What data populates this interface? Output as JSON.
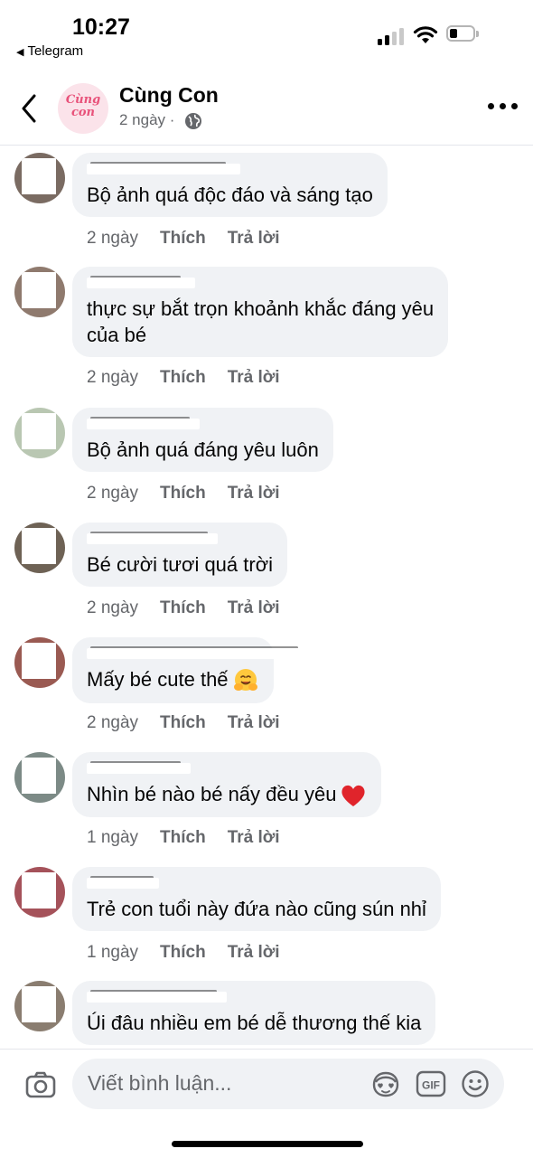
{
  "status_bar": {
    "time": "10:27",
    "back_app": "Telegram"
  },
  "header": {
    "page_name": "Cùng Con",
    "logo_text_line1": "Cùng",
    "logo_text_line2": "con",
    "time_ago": "2 ngày",
    "separator": "·"
  },
  "comments": [
    {
      "text": "Bộ ảnh quá độc đáo và sáng tạo",
      "time": "2 ngày",
      "like": "Thích",
      "reply": "Trả lời"
    },
    {
      "text": "thực sự bắt trọn khoảnh khắc đáng yêu\ncủa bé",
      "time": "2 ngày",
      "like": "Thích",
      "reply": "Trả lời"
    },
    {
      "text": "Bộ ảnh quá đáng yêu luôn",
      "time": "2 ngày",
      "like": "Thích",
      "reply": "Trả lời"
    },
    {
      "text": "Bé cười tươi quá trời",
      "time": "2 ngày",
      "like": "Thích",
      "reply": "Trả lời"
    },
    {
      "text": "Mấy bé cute thế",
      "time": "2 ngày",
      "like": "Thích",
      "reply": "Trả lời",
      "emoji": "hugging-face"
    },
    {
      "text": "Nhìn bé nào bé nấy đều yêu",
      "time": "1 ngày",
      "like": "Thích",
      "reply": "Trả lời",
      "emoji": "red-heart"
    },
    {
      "text": "Trẻ con tuổi này đứa nào cũng sún nhỉ",
      "time": "1 ngày",
      "like": "Thích",
      "reply": "Trả lời"
    },
    {
      "text": "Úi đâu nhiều em bé dễ thương thế kia",
      "time": "",
      "like": "",
      "reply": ""
    }
  ],
  "composer": {
    "placeholder": "Viết bình luận...",
    "gif_label": "GIF"
  },
  "colors": {
    "bubble": "#f0f2f5",
    "meta": "#65676b",
    "text": "#050505",
    "brand_pink": "#e8527a"
  },
  "icons": [
    "back-chevron-icon",
    "globe-icon",
    "more-dots-icon",
    "camera-icon",
    "avatar-sticker-icon",
    "gif-icon",
    "smiley-icon",
    "hugging-face-emoji",
    "red-heart-emoji"
  ]
}
